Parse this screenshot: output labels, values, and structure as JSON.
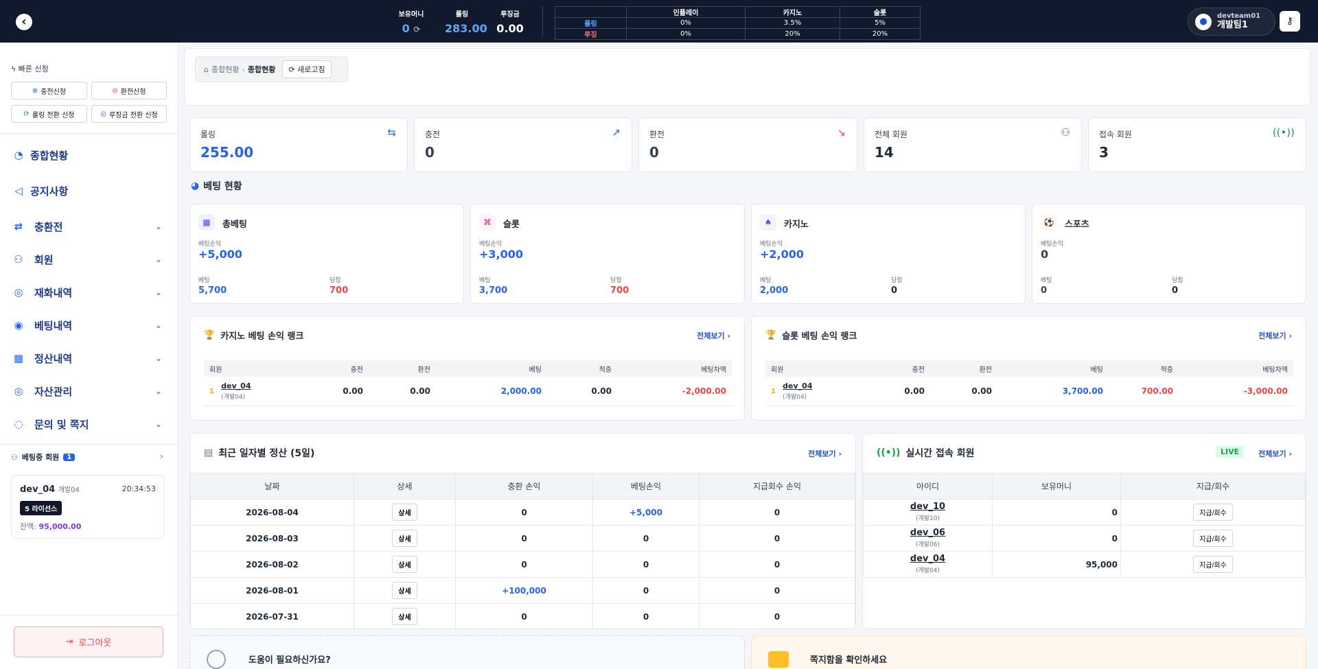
{
  "topbar": {
    "wallet": [
      {
        "label": "보유머니",
        "value": "0"
      },
      {
        "label": "롤링",
        "value": "283.00"
      },
      {
        "label": "루징금",
        "value": "0.00"
      }
    ],
    "rates": {
      "headers": [
        "",
        "인플레이",
        "카지노",
        "슬롯"
      ],
      "rows": [
        {
          "label": "롤링",
          "values": [
            "0%",
            "3.5%",
            "5%"
          ]
        },
        {
          "label": "루징",
          "values": [
            "0%",
            "20%",
            "20%"
          ]
        }
      ]
    },
    "user": {
      "id": "devteam01",
      "team": "개발팀1"
    }
  },
  "sidebar": {
    "quick_title": "빠른 신청",
    "quick_buttons": [
      "충전신청",
      "환전신청",
      "롤링 전환 신청",
      "루징금 전환 신청"
    ],
    "nav": [
      "종합현황",
      "공지사항",
      "충환전",
      "회원",
      "재화내역",
      "베팅내역",
      "정산내역",
      "자산관리",
      "문의 및 쪽지"
    ],
    "betting_members": {
      "title": "베팅중 회원",
      "count": "1",
      "member": {
        "name": "dev_04",
        "sub": "개발04",
        "time": "20:34:53",
        "license": "5 라이선스",
        "balance_label": "잔액:",
        "balance": "95,000.00"
      }
    },
    "logout": "로그아웃"
  },
  "breadcrumb": {
    "home": "종합현황",
    "current": "종합현황",
    "refresh": "새로고침"
  },
  "stats": [
    {
      "label": "롤링",
      "value": "255.00",
      "color": "#2563eb"
    },
    {
      "label": "충전",
      "value": "0",
      "color": "#374151"
    },
    {
      "label": "환전",
      "value": "0",
      "color": "#374151"
    },
    {
      "label": "전체 회원",
      "value": "14",
      "color": "#111827"
    },
    {
      "label": "접속 회원",
      "value": "3",
      "color": "#111827"
    }
  ],
  "betting_status": {
    "title": "베팅 현황",
    "cards": [
      {
        "title": "총베팅",
        "pl_label": "베팅손익",
        "pl": "+5,000",
        "bet_label": "베팅",
        "bet": "5,700",
        "win_label": "당첨",
        "win": "700"
      },
      {
        "title": "슬롯",
        "pl_label": "베팅손익",
        "pl": "+3,000",
        "bet_label": "베팅",
        "bet": "3,700",
        "win_label": "당첨",
        "win": "700"
      },
      {
        "title": "카지노",
        "pl_label": "베팅손익",
        "pl": "+2,000",
        "bet_label": "베팅",
        "bet": "2,000",
        "win_label": "당첨",
        "win": "0"
      },
      {
        "title": "스포츠",
        "pl_label": "베팅손익",
        "pl": "0",
        "bet_label": "베팅",
        "bet": "0",
        "win_label": "당첨",
        "win": "0"
      }
    ]
  },
  "casino_rank": {
    "title": "카지노 베팅 손익 랭크",
    "view_all": "전체보기",
    "headers": [
      "회원",
      "충전",
      "환전",
      "베팅",
      "적중",
      "베팅차액"
    ],
    "row": {
      "rank": "1",
      "user": "dev_04",
      "sub": "(개발04)",
      "charge": "0.00",
      "exchange": "0.00",
      "bet": "2,000.00",
      "hit": "0.00",
      "diff": "-2,000.00"
    }
  },
  "slot_rank": {
    "title": "슬롯 베팅 손익 랭크",
    "view_all": "전체보기",
    "headers": [
      "회원",
      "충전",
      "환전",
      "베팅",
      "적중",
      "베팅차액"
    ],
    "row": {
      "rank": "1",
      "user": "dev_04",
      "sub": "(개발04)",
      "charge": "0.00",
      "exchange": "0.00",
      "bet": "3,700.00",
      "hit": "700.00",
      "diff": "-3,000.00"
    }
  },
  "daily": {
    "title": "최근 일자별 정산 (5일)",
    "view_all": "전체보기",
    "headers": [
      "날짜",
      "상세",
      "충환 손익",
      "베팅손익",
      "지급회수 손익"
    ],
    "detail_label": "상세",
    "rows": [
      {
        "date": "2026-08-04",
        "charge": "0",
        "bet": "+5,000",
        "pay": "0"
      },
      {
        "date": "2026-08-03",
        "charge": "0",
        "bet": "0",
        "pay": "0"
      },
      {
        "date": "2026-08-02",
        "charge": "0",
        "bet": "0",
        "pay": "0"
      },
      {
        "date": "2026-08-01",
        "charge": "+100,000",
        "bet": "0",
        "pay": "0"
      },
      {
        "date": "2026-07-31",
        "charge": "0",
        "bet": "0",
        "pay": "0"
      }
    ]
  },
  "live_members": {
    "title": "실시간 접속 회원",
    "live": "LIVE",
    "view_all": "전체보기",
    "headers": [
      "아이디",
      "보유머니",
      "지급/회수"
    ],
    "btn": "지급/회수",
    "rows": [
      {
        "id": "dev_10",
        "sub": "(개발10)",
        "money": "0"
      },
      {
        "id": "dev_06",
        "sub": "(개발06)",
        "money": "0"
      },
      {
        "id": "dev_04",
        "sub": "(개발04)",
        "money": "95,000"
      }
    ]
  },
  "bottom": {
    "help": "도움이 필요하신가요?",
    "notes": "쪽지함을 확인하세요"
  }
}
